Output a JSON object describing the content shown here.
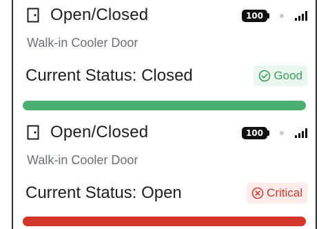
{
  "cards": [
    {
      "title": "Open/Closed",
      "battery": "100",
      "subtitle": "Walk-in Cooler Door",
      "status": "Current Status: Closed",
      "badge_label": "Good",
      "badge_type": "good",
      "bar_color": "#4caf72",
      "bar_fill": 1.0
    },
    {
      "title": "Open/Closed",
      "battery": "100",
      "subtitle": "Walk-in Cooler Door",
      "status": "Current Status: Open",
      "badge_label": "Critical",
      "badge_type": "critical",
      "bar_color": "#d3362b",
      "bar_fill": 1.0
    }
  ],
  "colors": {
    "good": "#3a9d5a",
    "critical": "#d23a2f",
    "text_primary": "#1f1f1f",
    "text_secondary": "#6b6f78"
  },
  "icons": {
    "door": "door-icon",
    "signal": "cellular-signal-icon",
    "good": "check-circle-icon",
    "critical": "x-circle-icon"
  }
}
